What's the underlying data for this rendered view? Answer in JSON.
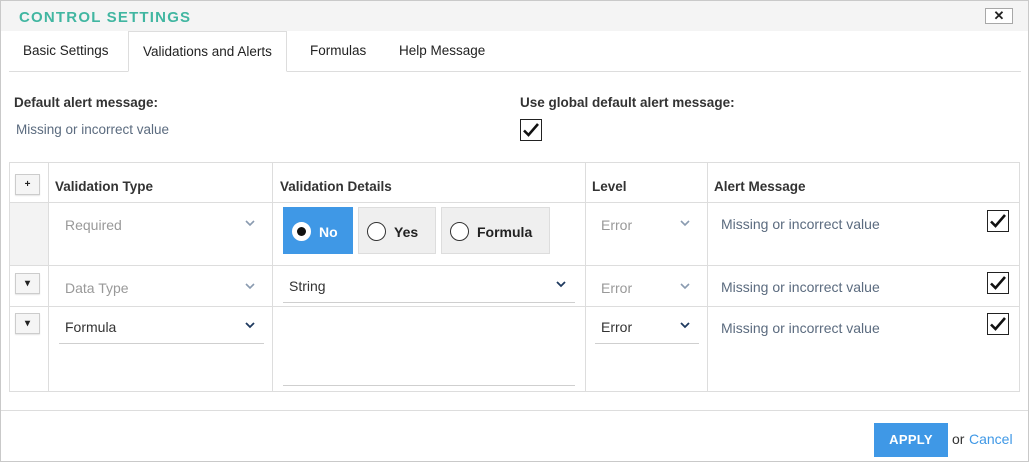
{
  "dialog": {
    "title": "CONTROL SETTINGS",
    "close_label": "✕"
  },
  "tabs": [
    {
      "label": "Basic Settings",
      "active": false
    },
    {
      "label": "Validations and Alerts",
      "active": true
    },
    {
      "label": "Formulas",
      "active": false
    },
    {
      "label": "Help Message",
      "active": false
    }
  ],
  "defaults": {
    "default_alert_label": "Default alert message:",
    "default_alert_value": "Missing or incorrect value",
    "global_label": "Use global default alert message:",
    "global_checked": true
  },
  "table": {
    "add_button": "+",
    "headers": {
      "type": "Validation Type",
      "details": "Validation Details",
      "level": "Level",
      "alert": "Alert Message"
    },
    "rows": [
      {
        "type": "Required",
        "type_enabled": false,
        "details_kind": "radio",
        "radio_options": [
          "No",
          "Yes",
          "Formula"
        ],
        "radio_selected": "No",
        "level": "Error",
        "level_enabled": false,
        "alert": "Missing or incorrect value",
        "checked": true
      },
      {
        "row_button": "▾",
        "type": "Data Type",
        "type_enabled": false,
        "details_kind": "select",
        "details_value": "String",
        "level": "Error",
        "level_enabled": false,
        "alert": "Missing or incorrect value",
        "checked": true
      },
      {
        "row_button": "▾",
        "type": "Formula",
        "type_enabled": true,
        "details_kind": "textarea",
        "details_value": "",
        "level": "Error",
        "level_enabled": true,
        "alert": "Missing or incorrect value",
        "checked": true
      }
    ]
  },
  "footer": {
    "apply_label": "APPLY",
    "or_label": "or",
    "cancel_label": "Cancel"
  },
  "colors": {
    "title": "#41b6a1",
    "accent": "#3f98e6"
  },
  "icons": {
    "close": "close-icon",
    "chevron": "chevron-down-icon",
    "check": "checkmark-icon",
    "grip": "resize-grip-icon"
  }
}
